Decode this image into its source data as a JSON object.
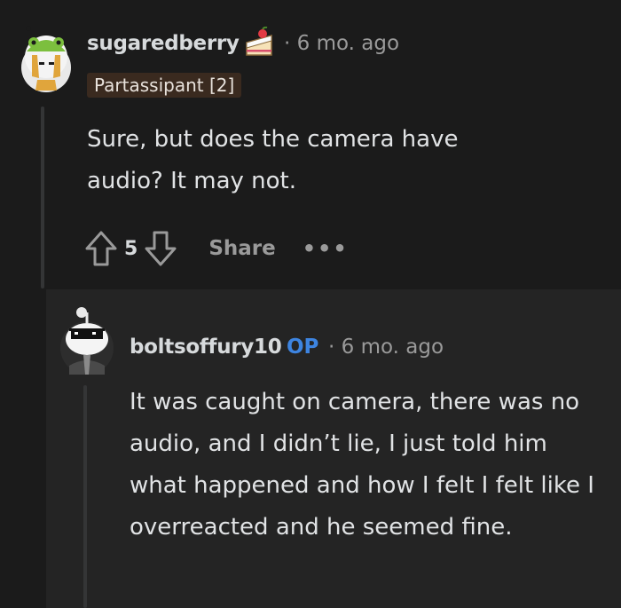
{
  "comment": {
    "username": "sugaredberry",
    "age": "6 mo. ago",
    "flair": "Partassipant [2]",
    "body": "Sure, but does the camera have audio? It may not.",
    "votes": "5",
    "share_label": "Share",
    "more_label": "•••"
  },
  "reply": {
    "username": "boltsoffury10",
    "op_label": "OP",
    "age": "6 mo. ago",
    "body": "It was caught on camera, there was no audio, and I didn’t lie, I just told him what happened and how I felt I felt like I overreacted and he seemed fine."
  },
  "icons": {
    "award": "cake-slice-icon",
    "upvote": "upvote-arrow-icon",
    "downvote": "downvote-arrow-icon"
  },
  "colors": {
    "background": "#1b1b1b",
    "reply_background": "#242424",
    "op_badge": "#3d84e0",
    "flair_background": "#3a2a1f"
  }
}
